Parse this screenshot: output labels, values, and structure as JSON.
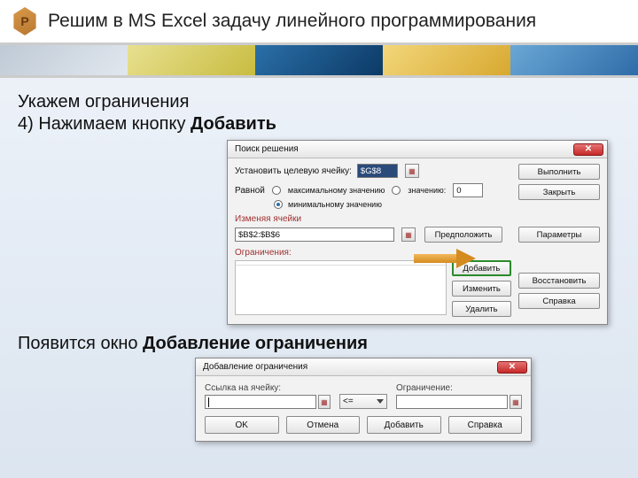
{
  "logo_letter": "P",
  "title": "Решим в MS Excel задачу линейного программирования",
  "body": {
    "line1": "Укажем ограничения",
    "line2_prefix": "4) Нажимаем кнопку ",
    "line2_bold": "Добавить",
    "line3_prefix": "Появится окно ",
    "line3_bold": "Добавление ограничения"
  },
  "solver": {
    "title": "Поиск решения",
    "close": "✕",
    "target_label": "Установить целевую ячейку:",
    "target_value": "$G$8",
    "equal_label": "Равной",
    "opt_max": "максимальному значению",
    "opt_val": "значению:",
    "opt_min": "минимальному значению",
    "val_input": "0",
    "change_label": "Изменяя ячейки",
    "change_value": "$B$2:$B$6",
    "constraints_label": "Ограничения:",
    "buttons": {
      "run": "Выполнить",
      "close": "Закрыть",
      "guess": "Предположить",
      "params": "Параметры",
      "add": "Добавить",
      "edit": "Изменить",
      "delete": "Удалить",
      "reset": "Восстановить",
      "help": "Справка"
    }
  },
  "add_dialog": {
    "title": "Добавление ограничения",
    "close": "✕",
    "cell_ref": "Ссылка на ячейку:",
    "constraint": "Ограничение:",
    "operator": "<=",
    "ok": "OK",
    "cancel": "Отмена",
    "add": "Добавить",
    "help": "Справка"
  }
}
